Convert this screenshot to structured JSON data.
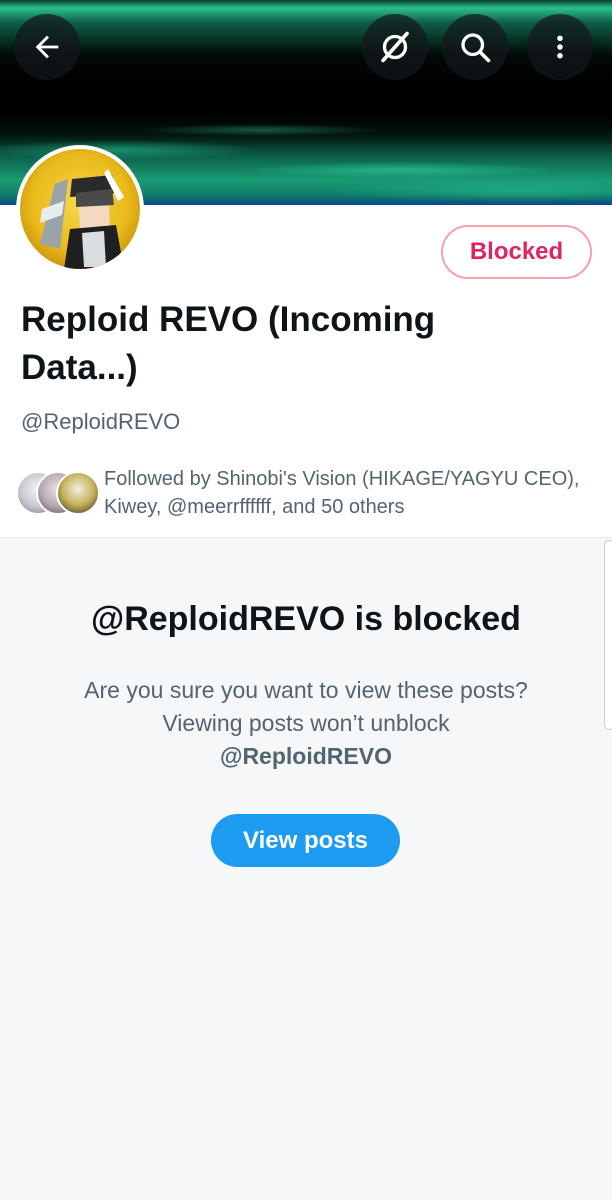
{
  "topbar": {
    "back_icon": "arrow-left-icon",
    "buttons": [
      {
        "icon": "no-signal-icon"
      },
      {
        "icon": "search-icon"
      },
      {
        "icon": "more-vertical-icon"
      }
    ]
  },
  "profile": {
    "display_name": "Reploid REVO (Incoming Data...)",
    "handle": "@ReploidREVO",
    "status_button": "Blocked",
    "followed_by": "Followed by Shinobi's Vision (HIKAGE/YAGYU CEO), Kiwey, @meerrffffff, and 50 others"
  },
  "blocked": {
    "title": "@ReploidREVO is blocked",
    "desc_prefix": "Are you sure you want to view these posts? Viewing posts won’t unblock",
    "desc_handle": "@ReploidREVO",
    "view_button": "View posts"
  },
  "colors": {
    "accent": "#1d9bf0",
    "blocked": "#e0245e",
    "secondary_text": "#536471"
  }
}
